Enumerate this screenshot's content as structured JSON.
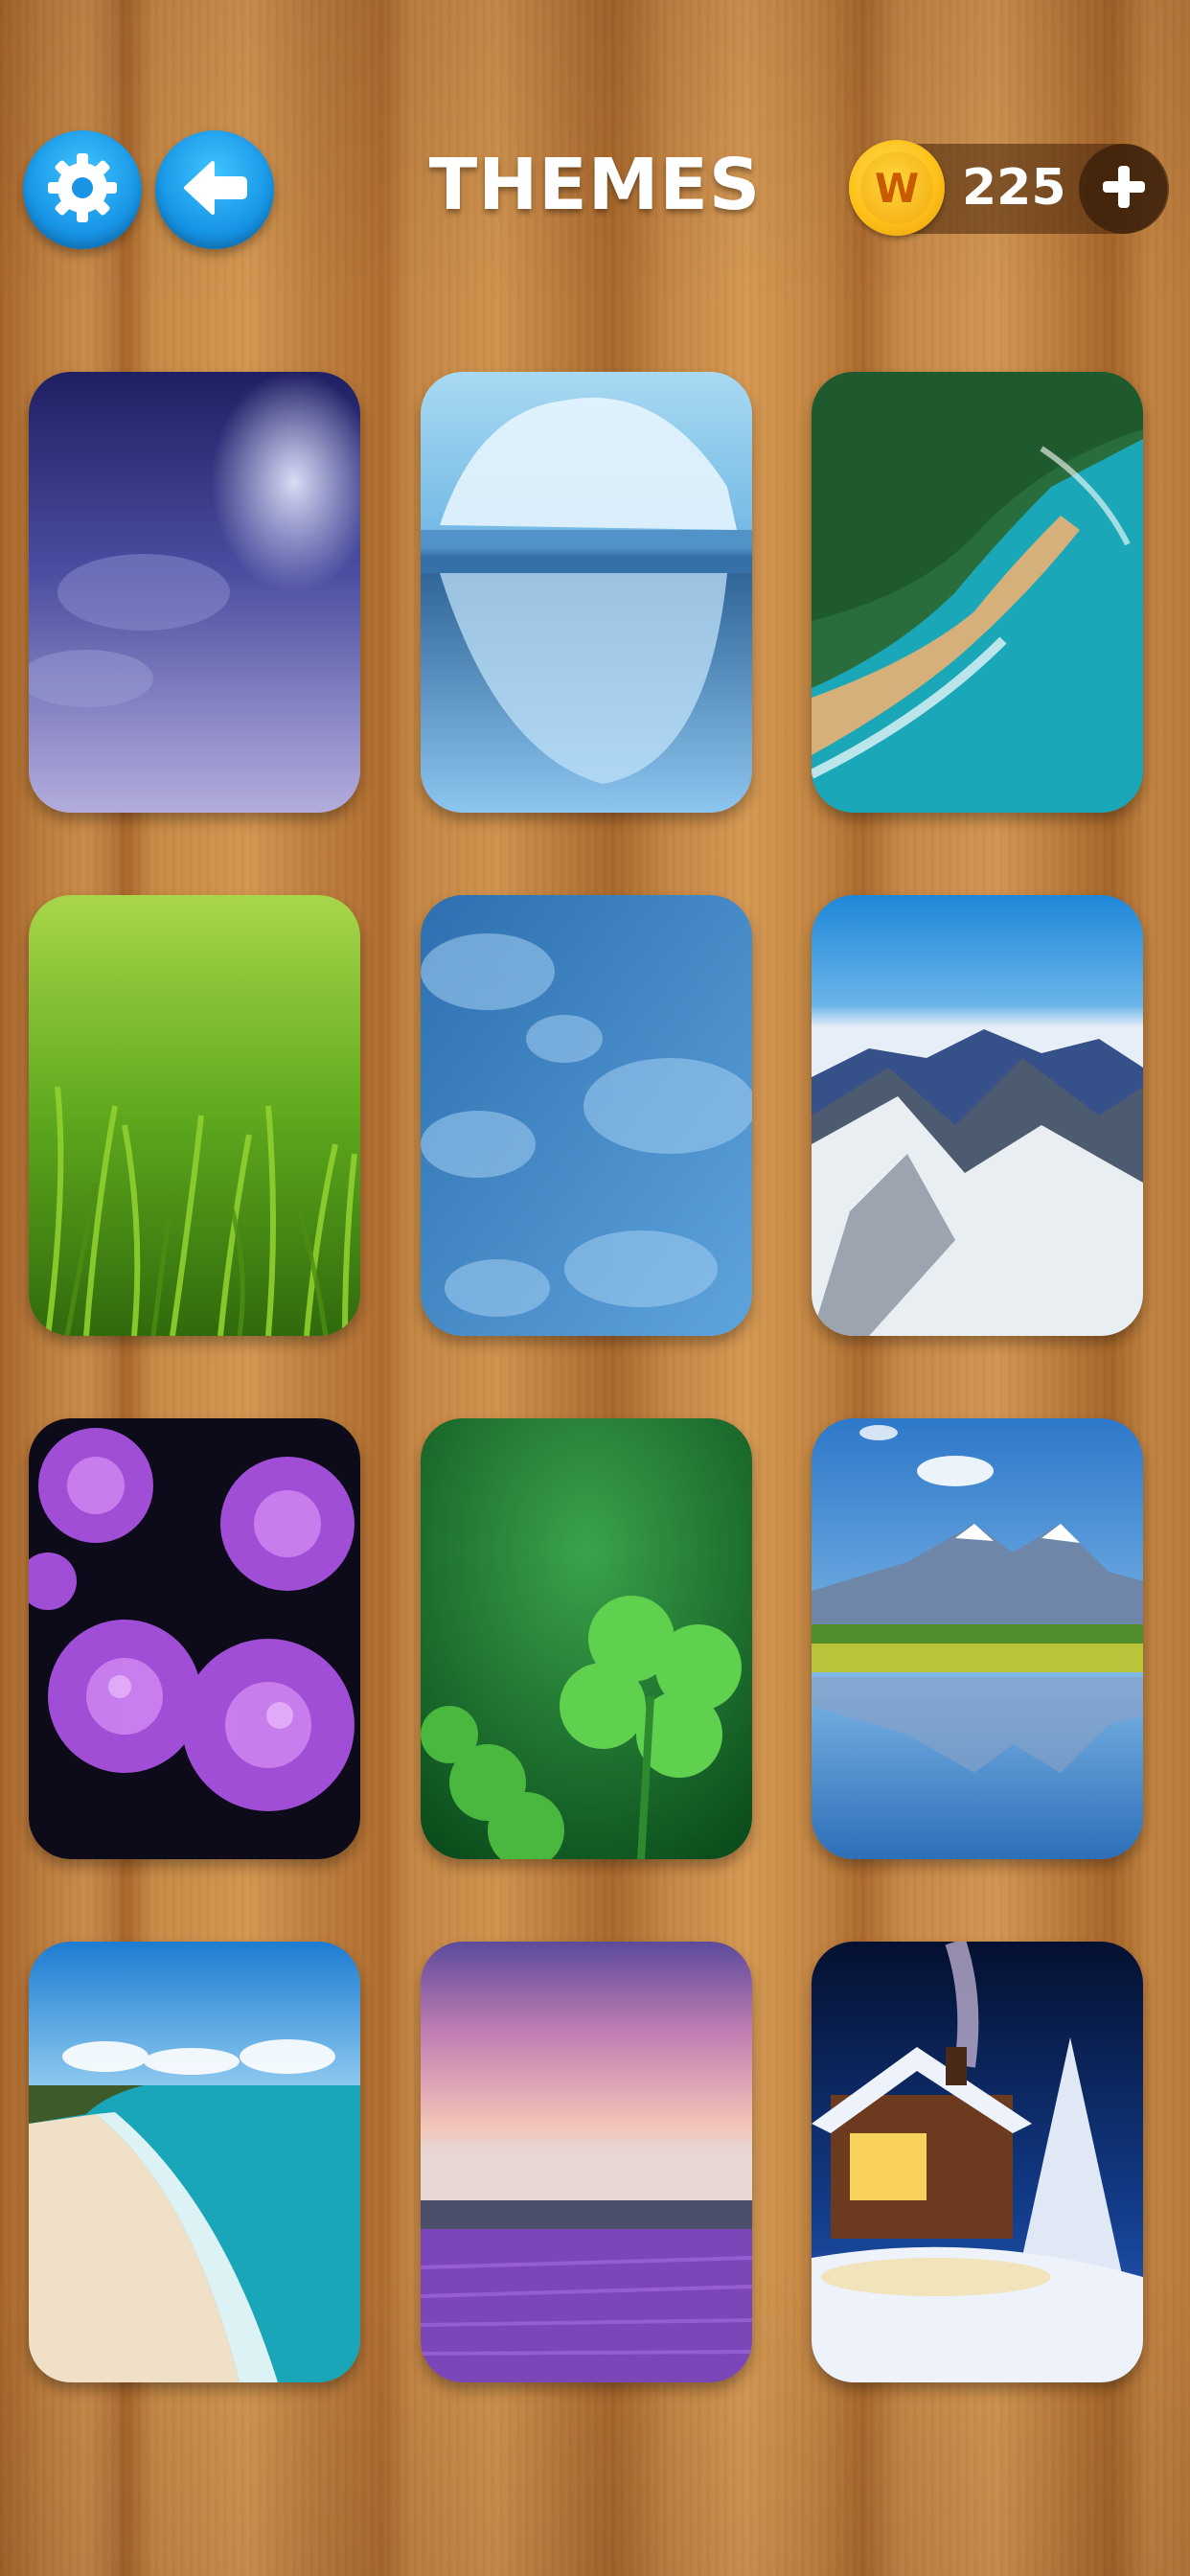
{
  "header": {
    "title": "THEMES",
    "coins": "225"
  },
  "icons": {
    "settings": "gear-icon",
    "back": "arrow-left-icon",
    "coin": "coin-w-icon",
    "add": "plus-icon"
  },
  "coin_letter": "W",
  "themes": [
    {
      "name": "night-clouds"
    },
    {
      "name": "iceberg"
    },
    {
      "name": "coastline"
    },
    {
      "name": "grass"
    },
    {
      "name": "blue-clouds"
    },
    {
      "name": "snowy-mountains"
    },
    {
      "name": "purple-flowers"
    },
    {
      "name": "clover"
    },
    {
      "name": "mountain-lake"
    },
    {
      "name": "beach"
    },
    {
      "name": "lavender-field"
    },
    {
      "name": "winter-cabin"
    }
  ]
}
